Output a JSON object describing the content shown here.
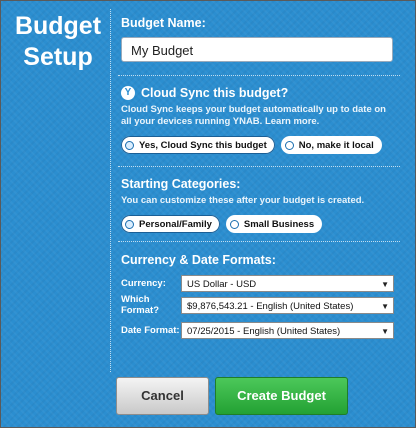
{
  "title": "Budget Setup",
  "budget_name": {
    "label": "Budget Name:",
    "value": "My Budget"
  },
  "cloud_sync": {
    "label": "Cloud Sync this budget?",
    "description": "Cloud Sync keeps your budget automatically up to date on all your devices running YNAB. Learn more.",
    "options": [
      "Yes, Cloud Sync this budget",
      "No, make it local"
    ],
    "selected": "Yes, Cloud Sync this budget"
  },
  "categories": {
    "label": "Starting Categories:",
    "description": "You can customize these after your budget is created.",
    "options": [
      "Personal/Family",
      "Small Business"
    ],
    "selected": "Personal/Family"
  },
  "formats": {
    "label": "Currency & Date Formats:",
    "currency_label": "Currency:",
    "currency_value": "US Dollar - USD",
    "number_format_label": "Which Format?",
    "number_format_value": "$9,876,543.21 - English (United States)",
    "date_format_label": "Date Format:",
    "date_format_value": "07/25/2015 - English (United States)"
  },
  "buttons": {
    "cancel": "Cancel",
    "create": "Create Budget"
  },
  "colors": {
    "background": "#2b8ed0",
    "create_button": "#2fb03f"
  }
}
